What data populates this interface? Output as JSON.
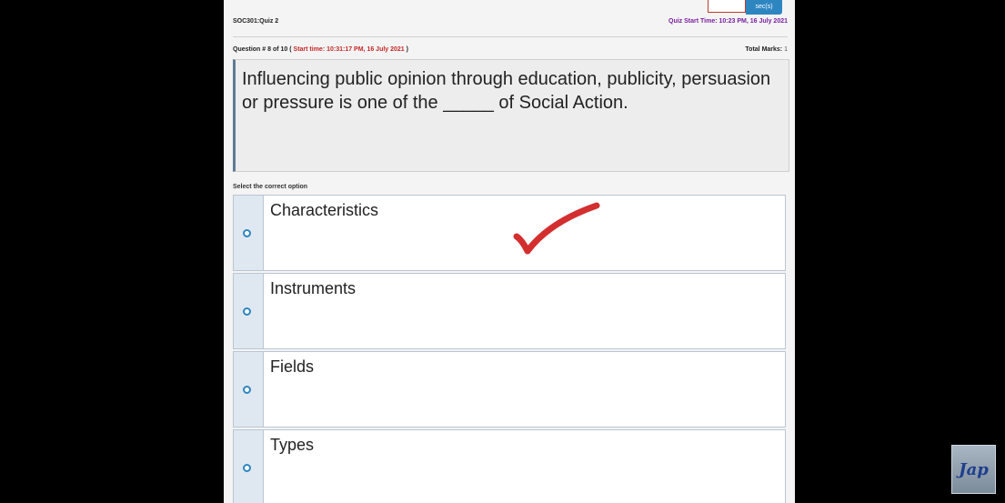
{
  "header": {
    "timer_unit": "sec(s)",
    "quiz_title": "SOC301:Quiz 2",
    "quiz_start_time": "Quiz Start Time: 10:23 PM, 16 July 2021"
  },
  "question": {
    "number_label": "Question # 8 of 10 (",
    "start_time": "Start time: 10:31:17 PM, 16 July 2021",
    "number_suffix": ")",
    "total_marks_label": "Total Marks:",
    "total_marks_value": "1",
    "text": "Influencing public opinion through education, publicity, persuasion or pressure is one of the _____ of Social Action."
  },
  "select_label": "Select the correct option",
  "options": [
    {
      "label": "Characteristics"
    },
    {
      "label": "Instruments"
    },
    {
      "label": "Fields"
    },
    {
      "label": "Types"
    }
  ],
  "annotation": {
    "mark": "checkmark",
    "color": "#d32f2f",
    "marked_option": "Characteristics"
  },
  "watermark": {
    "text": "Jap"
  },
  "colors": {
    "accent_blue": "#2e86c1",
    "start_time_red": "#c62828",
    "quiz_start_purple": "#7b1fa2"
  }
}
